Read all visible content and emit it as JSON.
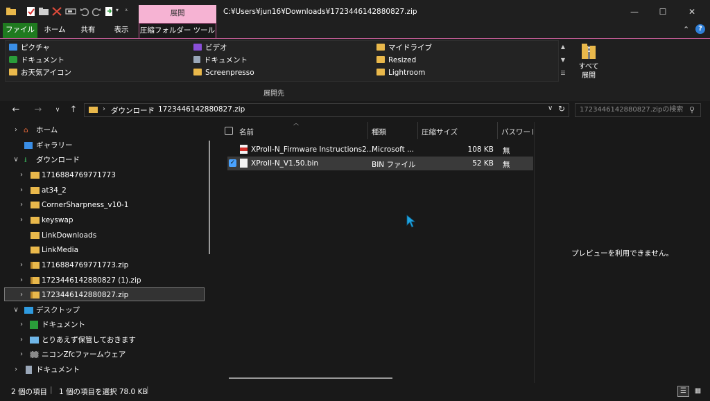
{
  "title_bar": {
    "context_tab_header": "展開",
    "path": "C:¥Users¥jun16¥Downloads¥1723446142880827.zip",
    "qat_icons": [
      "folder-icon",
      "properties-icon",
      "new-folder-icon",
      "delete-icon",
      "rename-icon",
      "undo-icon",
      "redo-icon",
      "new-item-icon",
      "customize-icon"
    ],
    "controls": {
      "minimize": "—",
      "maximize": "☐",
      "close": "✕"
    }
  },
  "ribbon_tabs": {
    "file": "ファイル",
    "home": "ホーム",
    "share": "共有",
    "view": "表示",
    "compressed_tools": "圧縮フォルダー ツール"
  },
  "ribbon": {
    "gallery": [
      {
        "label": "ピクチャ",
        "icon": "pictures-icon"
      },
      {
        "label": "ドキュメント",
        "icon": "documents-icon"
      },
      {
        "label": "お天気アイコン",
        "icon": "folder-icon"
      },
      {
        "label": "ビデオ",
        "icon": "videos-icon"
      },
      {
        "label": "ドキュメント",
        "icon": "documents-file-icon"
      },
      {
        "label": "Screenpresso",
        "icon": "folder-icon"
      },
      {
        "label": "マイドライブ",
        "icon": "folder-icon"
      },
      {
        "label": "Resized",
        "icon": "folder-icon"
      },
      {
        "label": "Lightroom",
        "icon": "folder-icon"
      }
    ],
    "expand_all_line1": "すべて",
    "expand_all_line2": "展開",
    "group_label": "展開先"
  },
  "address": {
    "crumbs": [
      "ダウンロード",
      "1723446142880827.zip"
    ],
    "search_placeholder": "1723446142880827.zipの検索"
  },
  "nav_pane": [
    {
      "label": "ホーム",
      "level": 0,
      "chevron": "right",
      "icon": "home-icon"
    },
    {
      "label": "ギャラリー",
      "level": 0,
      "chevron": "",
      "icon": "gallery-icon"
    },
    {
      "label": "ダウンロード",
      "level": 0,
      "chevron": "down",
      "icon": "download-icon"
    },
    {
      "label": "1716884769771773",
      "level": 1,
      "chevron": "right",
      "icon": "folder-icon"
    },
    {
      "label": "at34_2",
      "level": 1,
      "chevron": "right",
      "icon": "folder-icon"
    },
    {
      "label": "CornerSharpness_v10-1",
      "level": 1,
      "chevron": "right",
      "icon": "folder-icon"
    },
    {
      "label": "keyswap",
      "level": 1,
      "chevron": "right",
      "icon": "folder-icon"
    },
    {
      "label": "LinkDownloads",
      "level": 1,
      "chevron": "",
      "icon": "folder-icon"
    },
    {
      "label": "LinkMedia",
      "level": 1,
      "chevron": "",
      "icon": "folder-icon"
    },
    {
      "label": "1716884769771773.zip",
      "level": 1,
      "chevron": "right",
      "icon": "zip-folder-icon"
    },
    {
      "label": "1723446142880827 (1).zip",
      "level": 1,
      "chevron": "right",
      "icon": "zip-folder-icon"
    },
    {
      "label": "1723446142880827.zip",
      "level": 1,
      "chevron": "right",
      "icon": "zip-folder-icon"
    },
    {
      "label": "デスクトップ",
      "level": 0,
      "chevron": "down",
      "icon": "desktop-icon"
    },
    {
      "label": "ドキュメント",
      "level": 1,
      "chevron": "right",
      "icon": "documents-icon"
    },
    {
      "label": "とりあえず保管しておきます",
      "level": 1,
      "chevron": "right",
      "icon": "image-folder-icon"
    },
    {
      "label": "ニコンZfcファームウェア",
      "level": 1,
      "chevron": "right",
      "icon": "video-folder-icon"
    },
    {
      "label": "ドキュメント",
      "level": 0,
      "chevron": "right",
      "icon": "documents-file-icon"
    }
  ],
  "file_list": {
    "columns": {
      "name": "名前",
      "type": "種類",
      "size": "圧縮サイズ",
      "password": "パスワード保"
    },
    "rows": [
      {
        "name": "XProII-N_Firmware Instructions2...",
        "type": "Microsoft ...",
        "size": "108 KB",
        "password": "無",
        "icon": "pdf-icon",
        "selected": false
      },
      {
        "name": "XProII-N_V1.50.bin",
        "type": "BIN ファイル",
        "size": "52 KB",
        "password": "無",
        "icon": "file-icon",
        "selected": true
      }
    ]
  },
  "preview": {
    "message": "プレビューを利用できません。"
  },
  "status": {
    "items": "2 個の項目",
    "selected": "1 個の項目を選択  78.0 KB"
  },
  "colors": {
    "accent_pink": "#f6b3d3",
    "file_tab": "#1f7a1f",
    "folder": "#e9b84b",
    "checkbox": "#4aa3ff"
  }
}
